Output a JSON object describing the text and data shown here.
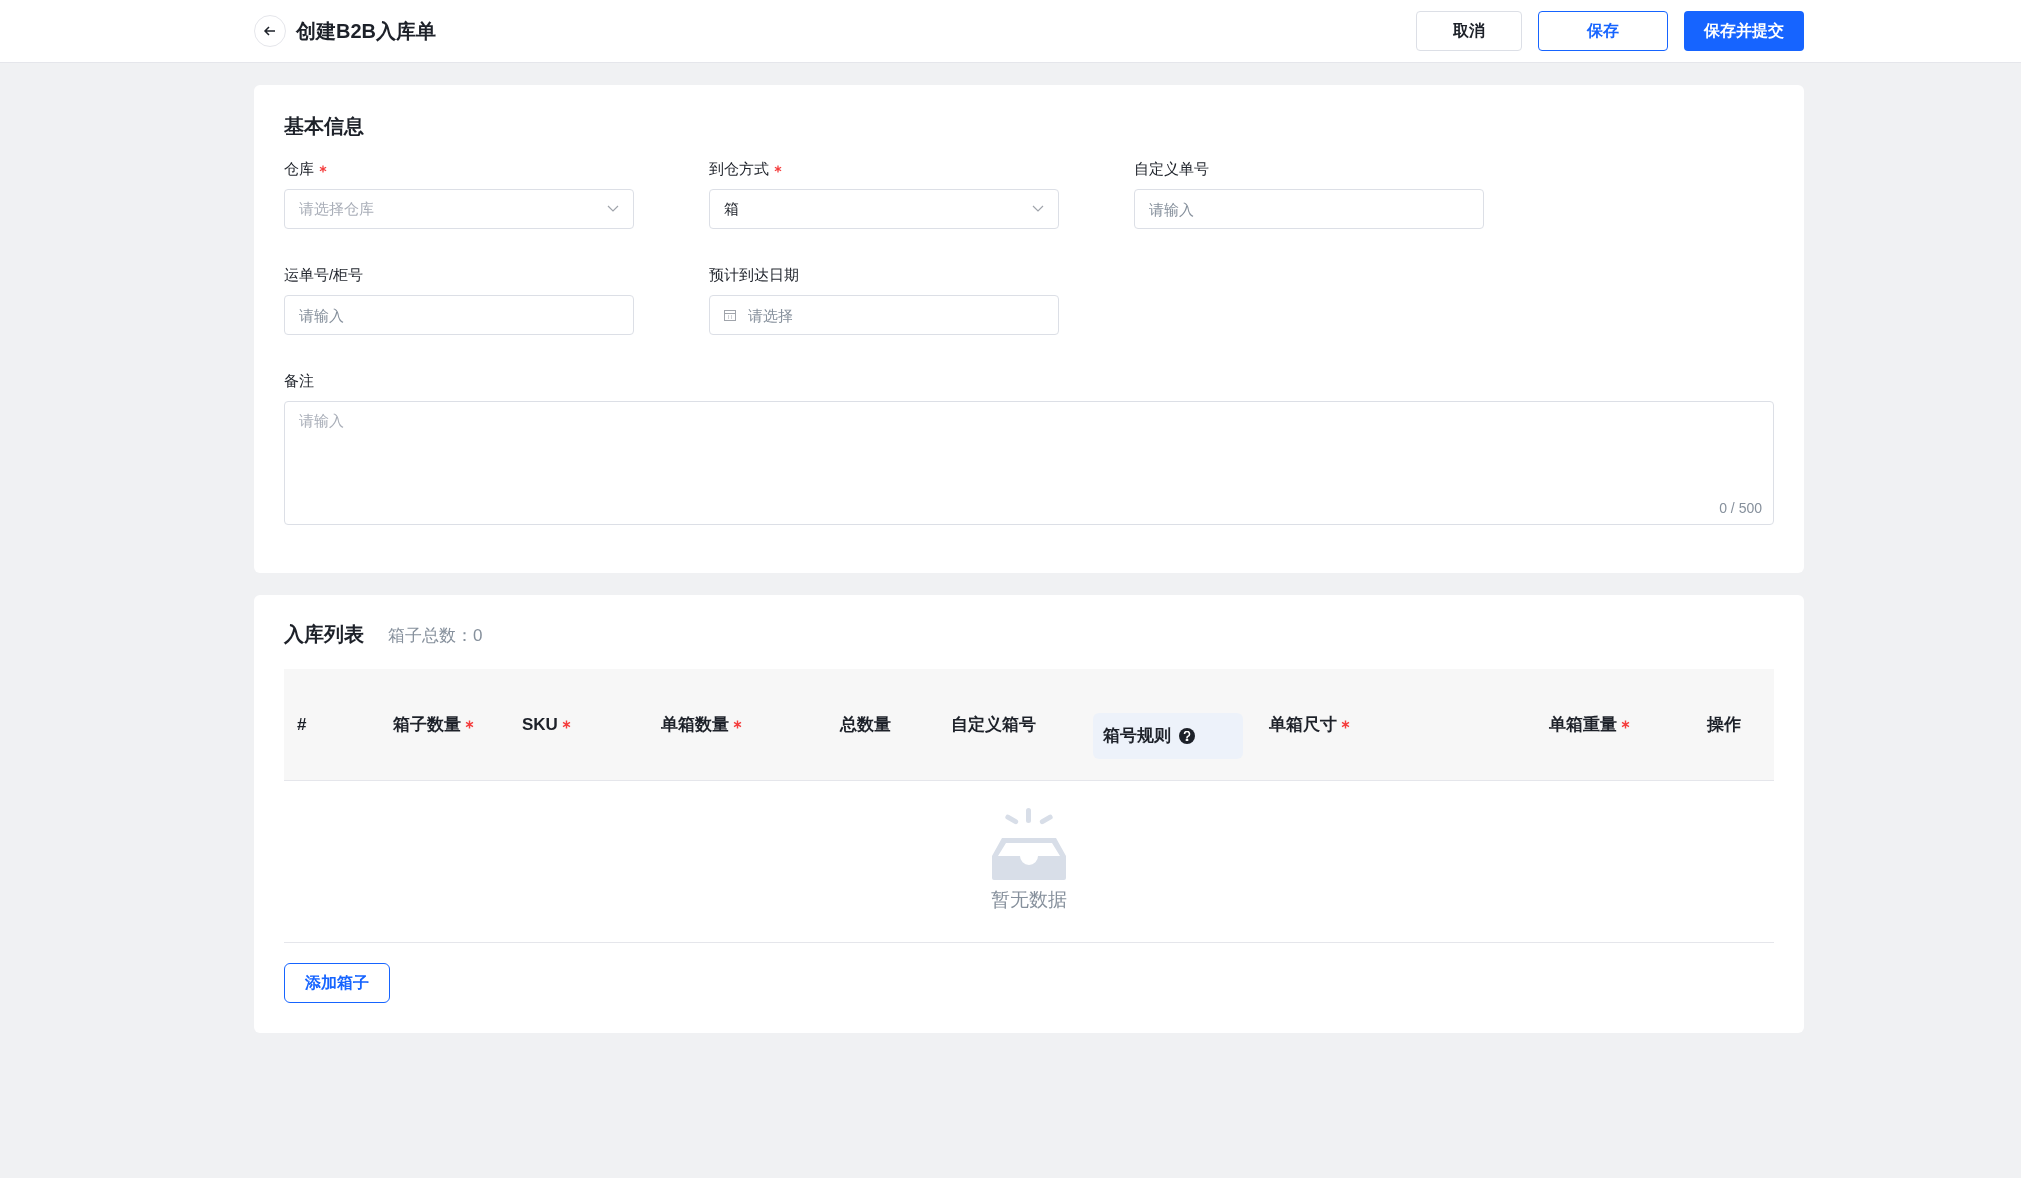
{
  "header": {
    "title": "创建B2B入库单",
    "buttons": [
      {
        "label": "取消",
        "kind": "default"
      },
      {
        "label": "保存",
        "kind": "outline"
      },
      {
        "label": "保存并提交",
        "kind": "primary"
      }
    ]
  },
  "basic_info": {
    "title": "基本信息",
    "fields": [
      {
        "label": "仓库",
        "required": true,
        "kind": "select",
        "placeholder": "请选择仓库"
      },
      {
        "label": "到仓方式",
        "required": true,
        "kind": "select",
        "value": "箱"
      },
      {
        "label": "自定义单号",
        "required": false,
        "kind": "input",
        "placeholder": "请输入"
      },
      {
        "label": "运单号/柜号",
        "required": false,
        "kind": "input",
        "placeholder": "请输入"
      },
      {
        "label": "预计到达日期",
        "required": false,
        "kind": "date",
        "placeholder": "请选择"
      }
    ],
    "remark": {
      "label": "备注",
      "placeholder": "请输入",
      "counter": "0 / 500"
    }
  },
  "inbound_list": {
    "title": "入库列表",
    "summary": "箱子总数：0",
    "columns": [
      {
        "label": "#",
        "required": false,
        "help": false,
        "highlighted": false
      },
      {
        "label": "箱子数量",
        "required": true,
        "help": false,
        "highlighted": false
      },
      {
        "label": "SKU",
        "required": true,
        "help": false,
        "highlighted": false
      },
      {
        "label": "单箱数量",
        "required": true,
        "help": false,
        "highlighted": false
      },
      {
        "label": "总数量",
        "required": false,
        "help": false,
        "highlighted": false
      },
      {
        "label": "自定义箱号",
        "required": false,
        "help": false,
        "highlighted": false
      },
      {
        "label": "箱号规则",
        "required": false,
        "help": true,
        "highlighted": true
      },
      {
        "label": "单箱尺寸",
        "required": true,
        "help": false,
        "highlighted": false
      },
      {
        "label": "单箱重量",
        "required": true,
        "help": false,
        "highlighted": false
      },
      {
        "label": "操作",
        "required": false,
        "help": false,
        "highlighted": false
      }
    ],
    "empty_text": "暂无数据",
    "add_button": "添加箱子"
  }
}
